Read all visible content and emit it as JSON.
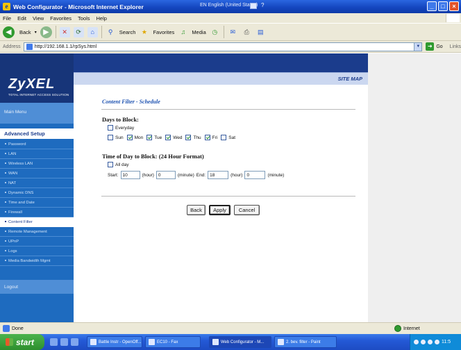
{
  "window": {
    "title": "Web Configurator - Microsoft Internet Explorer",
    "language": "EN English (United States)",
    "help_glyph": "?",
    "buttons": {
      "minimize": "_",
      "maximize": "□",
      "close": "×"
    }
  },
  "menu": [
    "File",
    "Edit",
    "View",
    "Favorites",
    "Tools",
    "Help"
  ],
  "toolbar": {
    "back": "Back",
    "search": "Search",
    "favorites": "Favorites",
    "media": "Media"
  },
  "address": {
    "label": "Address",
    "url": "http://192.168.1.1/rpSys.html",
    "go": "Go",
    "links": "Links"
  },
  "header": {
    "logo": "ZyXEL",
    "tagline": "TOTAL INTERNET ACCESS SOLUTION",
    "site_map": "SITE MAP"
  },
  "sidebar": {
    "main_menu": "Main Menu",
    "advanced_setup": "Advanced Setup",
    "items": [
      "Password",
      "LAN",
      "Wireless LAN",
      "WAN",
      "NAT",
      "Dynamic DNS",
      "Time and Date",
      "Firewall",
      "Content Filter",
      "Remote Management",
      "UPnP",
      "Logs",
      "Media Bandwidth Mgmt"
    ],
    "active_item": "Content Filter",
    "logout": "Logout"
  },
  "form": {
    "page_title": "Content Filter - Schedule",
    "days_heading": "Days to Block:",
    "everyday": {
      "label": "Everyday",
      "checked": false
    },
    "days": [
      {
        "label": "Sun",
        "checked": false
      },
      {
        "label": "Mon",
        "checked": true
      },
      {
        "label": "Tue",
        "checked": true
      },
      {
        "label": "Wed",
        "checked": true
      },
      {
        "label": "Thu",
        "checked": true
      },
      {
        "label": "Fri",
        "checked": true
      },
      {
        "label": "Sat",
        "checked": false
      }
    ],
    "time_heading": "Time of Day to Block: (24 Hour Format)",
    "allday": {
      "label": "All day",
      "checked": false
    },
    "start_label": "Start:",
    "start_hour": "10",
    "start_minute": "0",
    "end_label": "End:",
    "end_hour": "18",
    "end_minute": "0",
    "hour_unit": "(hour)",
    "minute_unit": "(minute)",
    "buttons": {
      "back": "Back",
      "apply": "Apply",
      "cancel": "Cancel"
    }
  },
  "status": {
    "text": "Done",
    "zone": "Internet"
  },
  "taskbar": {
    "start": "start",
    "tasks": [
      "Battle Instr - OpenOff...",
      "EC10 - Fax",
      "Web Configurator - M...",
      "2. bev. filter - Paint"
    ],
    "active_task": "Web Configurator - M...",
    "clock": "11:5"
  }
}
